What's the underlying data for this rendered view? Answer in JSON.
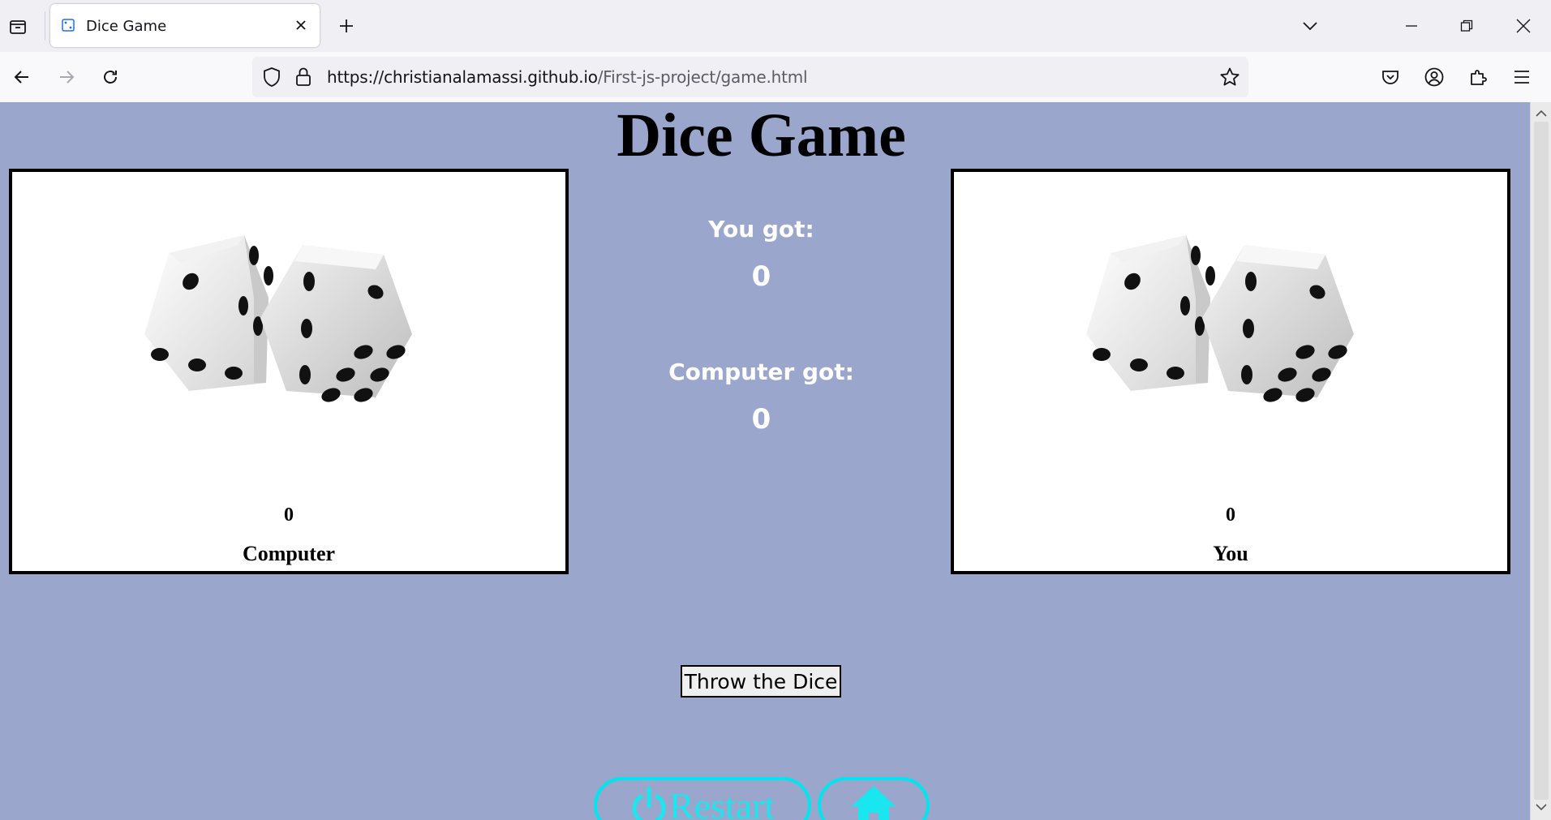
{
  "browser": {
    "tab_title": "Dice Game",
    "url_host": "https://christianalamassi.github.io",
    "url_path": "/First-js-project/game.html"
  },
  "page": {
    "title": "Dice Game",
    "computer_box": {
      "score": "0",
      "name": "Computer"
    },
    "you_box": {
      "score": "0",
      "name": "You"
    },
    "you_got_label": "You got:",
    "you_got_value": "0",
    "computer_got_label": "Computer got:",
    "computer_got_value": "0",
    "throw_button": "Throw the Dice",
    "restart_label": "Restart"
  },
  "colors": {
    "page_background": "#9aa6cc",
    "accent_cyan": "#00e5ee"
  }
}
